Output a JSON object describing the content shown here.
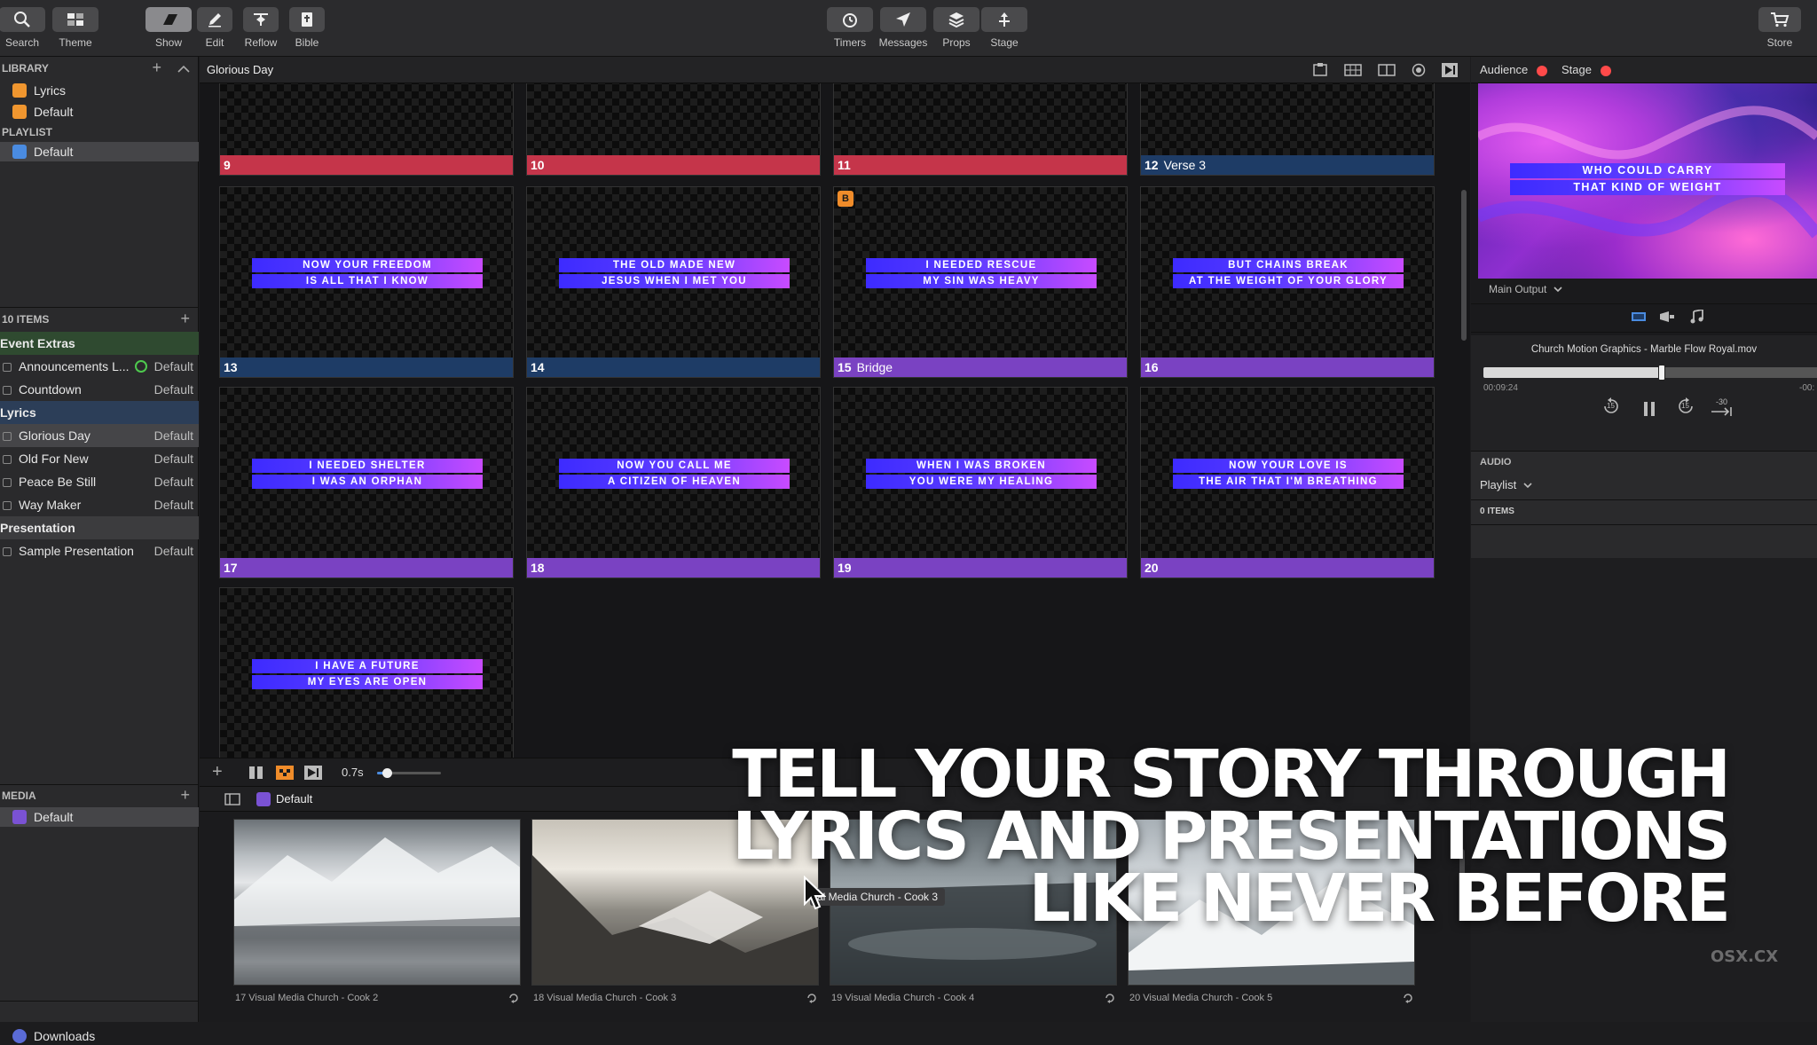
{
  "toolbar": {
    "left": [
      {
        "label": "Search",
        "icon": "search-icon"
      },
      {
        "label": "Theme",
        "icon": "theme-icon"
      }
    ],
    "modes": [
      {
        "label": "Show",
        "icon": "show-icon",
        "active": true
      },
      {
        "label": "Edit",
        "icon": "edit-icon"
      },
      {
        "label": "Reflow",
        "icon": "reflow-icon"
      },
      {
        "label": "Bible",
        "icon": "bible-icon"
      }
    ],
    "center": [
      {
        "label": "Timers",
        "icon": "timer-icon"
      },
      {
        "label": "Messages",
        "icon": "messages-icon"
      },
      {
        "label": "Props",
        "icon": "props-icon"
      },
      {
        "label": "Stage",
        "icon": "stage-icon"
      }
    ],
    "store": {
      "label": "Store",
      "icon": "cart-icon"
    }
  },
  "library": {
    "header": "LIBRARY",
    "items": [
      "Lyrics",
      "Default"
    ],
    "playlist_header": "PLAYLIST",
    "playlist_item": "Default"
  },
  "items": {
    "count_label": "10 ITEMS",
    "groups": [
      {
        "name": "Event Extras",
        "rows": [
          {
            "name": "Announcements L...",
            "theme": "Default",
            "linked": true
          },
          {
            "name": "Countdown",
            "theme": "Default"
          }
        ]
      },
      {
        "name": "Lyrics",
        "rows": [
          {
            "name": "Glorious Day",
            "theme": "Default",
            "selected": true
          },
          {
            "name": "Old For New",
            "theme": "Default"
          },
          {
            "name": "Peace Be Still",
            "theme": "Default"
          },
          {
            "name": "Way Maker",
            "theme": "Default"
          }
        ]
      },
      {
        "name": "Presentation",
        "rows": [
          {
            "name": "Sample Presentation",
            "theme": "Default"
          }
        ]
      }
    ]
  },
  "media_sidebar": {
    "header": "MEDIA",
    "item": "Default",
    "downloads": "Downloads"
  },
  "presentation": {
    "title": "Glorious Day"
  },
  "slides": [
    {
      "num": "9",
      "name": "",
      "lines": [],
      "color": "#c5354a"
    },
    {
      "num": "10",
      "name": "",
      "lines": [],
      "color": "#c5354a"
    },
    {
      "num": "11",
      "name": "",
      "lines": [],
      "color": "#c5354a"
    },
    {
      "num": "12",
      "name": "Verse 3",
      "lines": [],
      "color": "#1e3c66"
    },
    {
      "num": "13",
      "name": "",
      "lines": [
        "NOW YOUR FREEDOM",
        "IS ALL THAT I KNOW"
      ],
      "color": "#1e3c66"
    },
    {
      "num": "14",
      "name": "",
      "lines": [
        "THE OLD MADE NEW",
        "JESUS WHEN I MET YOU"
      ],
      "color": "#1e3c66"
    },
    {
      "num": "15",
      "name": "Bridge",
      "lines": [
        "I NEEDED RESCUE",
        "MY SIN WAS HEAVY"
      ],
      "color": "#7a42c2",
      "badge": "B"
    },
    {
      "num": "16",
      "name": "",
      "lines": [
        "BUT CHAINS BREAK",
        "AT THE WEIGHT OF YOUR GLORY"
      ],
      "color": "#7a42c2"
    },
    {
      "num": "17",
      "name": "",
      "lines": [
        "I NEEDED SHELTER",
        "I WAS AN ORPHAN"
      ],
      "color": "#7a42c2"
    },
    {
      "num": "18",
      "name": "",
      "lines": [
        "NOW YOU CALL ME",
        "A CITIZEN OF HEAVEN"
      ],
      "color": "#7a42c2"
    },
    {
      "num": "19",
      "name": "",
      "lines": [
        "WHEN I WAS BROKEN",
        "YOU WERE MY HEALING"
      ],
      "color": "#7a42c2"
    },
    {
      "num": "20",
      "name": "",
      "lines": [
        "NOW YOUR LOVE IS",
        "THE AIR THAT I'M BREATHING"
      ],
      "color": "#7a42c2"
    },
    {
      "num": "",
      "name": "",
      "lines": [
        "I HAVE A FUTURE",
        "MY EYES ARE OPEN"
      ],
      "color": "#7a42c2"
    }
  ],
  "slide_footer": {
    "transition": "0.7s",
    "transition_fraction": 0.15
  },
  "media_bin": {
    "playlist": "Default",
    "hover_tooltip": "al Media Church - Cook 3",
    "thumbs": [
      {
        "caption": "17 Visual Media Church - Cook 2"
      },
      {
        "caption": "18 Visual Media Church - Cook 3"
      },
      {
        "caption": "19 Visual Media Church - Cook 4"
      },
      {
        "caption": "20 Visual Media Church - Cook 5"
      }
    ]
  },
  "output": {
    "audience": "Audience",
    "stage": "Stage",
    "preview_lines": [
      "WHO COULD CARRY",
      "THAT KIND OF WEIGHT"
    ],
    "screen": "Main Output",
    "file": "Church Motion Graphics - Marble Flow Royal.mov",
    "elapsed": "00:09:24",
    "remaining": "-00:",
    "progress": 0.53,
    "skip_back": "15",
    "skip_forward": "15",
    "skip_end": "-30"
  },
  "audio": {
    "header": "AUDIO",
    "playlist": "Playlist",
    "count": "0 ITEMS"
  },
  "promo": {
    "lines": [
      "TELL YOUR STORY THROUGH",
      "LYRICS AND PRESENTATIONS",
      "LIKE NEVER BEFORE"
    ]
  },
  "watermark": "OSX.CX",
  "colors": {
    "accent": "#3d2bff",
    "live": "#ff3b3b",
    "orange": "#f08c2a"
  }
}
